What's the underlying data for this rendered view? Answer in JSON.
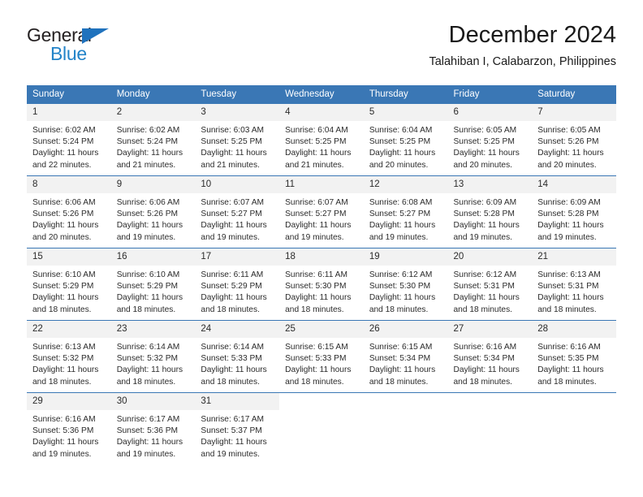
{
  "brand": {
    "name_part1": "General",
    "name_part2": "Blue",
    "triangle_color": "#1f72bd",
    "blue_text_color": "#2283c8"
  },
  "header": {
    "title": "December 2024",
    "subtitle": "Talahiban I, Calabarzon, Philippines",
    "header_bg_color": "#3a77b5",
    "daynum_bg_color": "#f2f2f2"
  },
  "weekdays": [
    "Sunday",
    "Monday",
    "Tuesday",
    "Wednesday",
    "Thursday",
    "Friday",
    "Saturday"
  ],
  "labels": {
    "sunrise_prefix": "Sunrise: ",
    "sunset_prefix": "Sunset: ",
    "daylight_prefix": "Daylight: "
  },
  "weeks": [
    [
      {
        "day": "1",
        "sunrise": "Sunrise: 6:02 AM",
        "sunset": "Sunset: 5:24 PM",
        "daylight": "Daylight: 11 hours and 22 minutes."
      },
      {
        "day": "2",
        "sunrise": "Sunrise: 6:02 AM",
        "sunset": "Sunset: 5:24 PM",
        "daylight": "Daylight: 11 hours and 21 minutes."
      },
      {
        "day": "3",
        "sunrise": "Sunrise: 6:03 AM",
        "sunset": "Sunset: 5:25 PM",
        "daylight": "Daylight: 11 hours and 21 minutes."
      },
      {
        "day": "4",
        "sunrise": "Sunrise: 6:04 AM",
        "sunset": "Sunset: 5:25 PM",
        "daylight": "Daylight: 11 hours and 21 minutes."
      },
      {
        "day": "5",
        "sunrise": "Sunrise: 6:04 AM",
        "sunset": "Sunset: 5:25 PM",
        "daylight": "Daylight: 11 hours and 20 minutes."
      },
      {
        "day": "6",
        "sunrise": "Sunrise: 6:05 AM",
        "sunset": "Sunset: 5:25 PM",
        "daylight": "Daylight: 11 hours and 20 minutes."
      },
      {
        "day": "7",
        "sunrise": "Sunrise: 6:05 AM",
        "sunset": "Sunset: 5:26 PM",
        "daylight": "Daylight: 11 hours and 20 minutes."
      }
    ],
    [
      {
        "day": "8",
        "sunrise": "Sunrise: 6:06 AM",
        "sunset": "Sunset: 5:26 PM",
        "daylight": "Daylight: 11 hours and 20 minutes."
      },
      {
        "day": "9",
        "sunrise": "Sunrise: 6:06 AM",
        "sunset": "Sunset: 5:26 PM",
        "daylight": "Daylight: 11 hours and 19 minutes."
      },
      {
        "day": "10",
        "sunrise": "Sunrise: 6:07 AM",
        "sunset": "Sunset: 5:27 PM",
        "daylight": "Daylight: 11 hours and 19 minutes."
      },
      {
        "day": "11",
        "sunrise": "Sunrise: 6:07 AM",
        "sunset": "Sunset: 5:27 PM",
        "daylight": "Daylight: 11 hours and 19 minutes."
      },
      {
        "day": "12",
        "sunrise": "Sunrise: 6:08 AM",
        "sunset": "Sunset: 5:27 PM",
        "daylight": "Daylight: 11 hours and 19 minutes."
      },
      {
        "day": "13",
        "sunrise": "Sunrise: 6:09 AM",
        "sunset": "Sunset: 5:28 PM",
        "daylight": "Daylight: 11 hours and 19 minutes."
      },
      {
        "day": "14",
        "sunrise": "Sunrise: 6:09 AM",
        "sunset": "Sunset: 5:28 PM",
        "daylight": "Daylight: 11 hours and 19 minutes."
      }
    ],
    [
      {
        "day": "15",
        "sunrise": "Sunrise: 6:10 AM",
        "sunset": "Sunset: 5:29 PM",
        "daylight": "Daylight: 11 hours and 18 minutes."
      },
      {
        "day": "16",
        "sunrise": "Sunrise: 6:10 AM",
        "sunset": "Sunset: 5:29 PM",
        "daylight": "Daylight: 11 hours and 18 minutes."
      },
      {
        "day": "17",
        "sunrise": "Sunrise: 6:11 AM",
        "sunset": "Sunset: 5:29 PM",
        "daylight": "Daylight: 11 hours and 18 minutes."
      },
      {
        "day": "18",
        "sunrise": "Sunrise: 6:11 AM",
        "sunset": "Sunset: 5:30 PM",
        "daylight": "Daylight: 11 hours and 18 minutes."
      },
      {
        "day": "19",
        "sunrise": "Sunrise: 6:12 AM",
        "sunset": "Sunset: 5:30 PM",
        "daylight": "Daylight: 11 hours and 18 minutes."
      },
      {
        "day": "20",
        "sunrise": "Sunrise: 6:12 AM",
        "sunset": "Sunset: 5:31 PM",
        "daylight": "Daylight: 11 hours and 18 minutes."
      },
      {
        "day": "21",
        "sunrise": "Sunrise: 6:13 AM",
        "sunset": "Sunset: 5:31 PM",
        "daylight": "Daylight: 11 hours and 18 minutes."
      }
    ],
    [
      {
        "day": "22",
        "sunrise": "Sunrise: 6:13 AM",
        "sunset": "Sunset: 5:32 PM",
        "daylight": "Daylight: 11 hours and 18 minutes."
      },
      {
        "day": "23",
        "sunrise": "Sunrise: 6:14 AM",
        "sunset": "Sunset: 5:32 PM",
        "daylight": "Daylight: 11 hours and 18 minutes."
      },
      {
        "day": "24",
        "sunrise": "Sunrise: 6:14 AM",
        "sunset": "Sunset: 5:33 PM",
        "daylight": "Daylight: 11 hours and 18 minutes."
      },
      {
        "day": "25",
        "sunrise": "Sunrise: 6:15 AM",
        "sunset": "Sunset: 5:33 PM",
        "daylight": "Daylight: 11 hours and 18 minutes."
      },
      {
        "day": "26",
        "sunrise": "Sunrise: 6:15 AM",
        "sunset": "Sunset: 5:34 PM",
        "daylight": "Daylight: 11 hours and 18 minutes."
      },
      {
        "day": "27",
        "sunrise": "Sunrise: 6:16 AM",
        "sunset": "Sunset: 5:34 PM",
        "daylight": "Daylight: 11 hours and 18 minutes."
      },
      {
        "day": "28",
        "sunrise": "Sunrise: 6:16 AM",
        "sunset": "Sunset: 5:35 PM",
        "daylight": "Daylight: 11 hours and 18 minutes."
      }
    ],
    [
      {
        "day": "29",
        "sunrise": "Sunrise: 6:16 AM",
        "sunset": "Sunset: 5:36 PM",
        "daylight": "Daylight: 11 hours and 19 minutes."
      },
      {
        "day": "30",
        "sunrise": "Sunrise: 6:17 AM",
        "sunset": "Sunset: 5:36 PM",
        "daylight": "Daylight: 11 hours and 19 minutes."
      },
      {
        "day": "31",
        "sunrise": "Sunrise: 6:17 AM",
        "sunset": "Sunset: 5:37 PM",
        "daylight": "Daylight: 11 hours and 19 minutes."
      },
      {
        "day": "",
        "sunrise": "",
        "sunset": "",
        "daylight": ""
      },
      {
        "day": "",
        "sunrise": "",
        "sunset": "",
        "daylight": ""
      },
      {
        "day": "",
        "sunrise": "",
        "sunset": "",
        "daylight": ""
      },
      {
        "day": "",
        "sunrise": "",
        "sunset": "",
        "daylight": ""
      }
    ]
  ]
}
